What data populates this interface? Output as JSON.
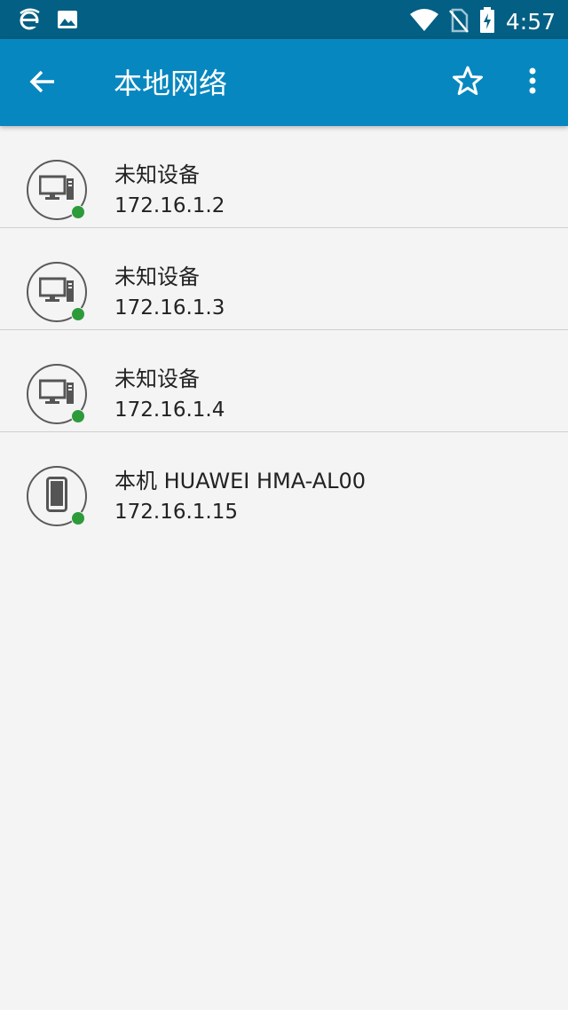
{
  "status_bar": {
    "left_icons": [
      "ie-browser-icon",
      "image-icon"
    ],
    "right_icons": [
      "wifi-icon",
      "no-sim-icon",
      "battery-charging-icon"
    ],
    "time": "4:57"
  },
  "app_bar": {
    "title": "本地网络",
    "icons": {
      "back": "arrow-back-icon",
      "favorite": "star-outline-icon",
      "more": "more-vertical-icon"
    }
  },
  "devices": [
    {
      "name": "未知设备",
      "ip": "172.16.1.2",
      "type": "desktop-computer-icon",
      "online": true
    },
    {
      "name": "未知设备",
      "ip": "172.16.1.3",
      "type": "desktop-computer-icon",
      "online": true
    },
    {
      "name": "未知设备",
      "ip": "172.16.1.4",
      "type": "desktop-computer-icon",
      "online": true
    },
    {
      "name": "本机 HUAWEI HMA-AL00",
      "ip": "172.16.1.15",
      "type": "smartphone-icon",
      "online": true
    }
  ],
  "colors": {
    "status_bar": "#035f83",
    "app_bar": "#0787bf",
    "online": "#2e9b3a",
    "background": "#f4f4f4"
  }
}
